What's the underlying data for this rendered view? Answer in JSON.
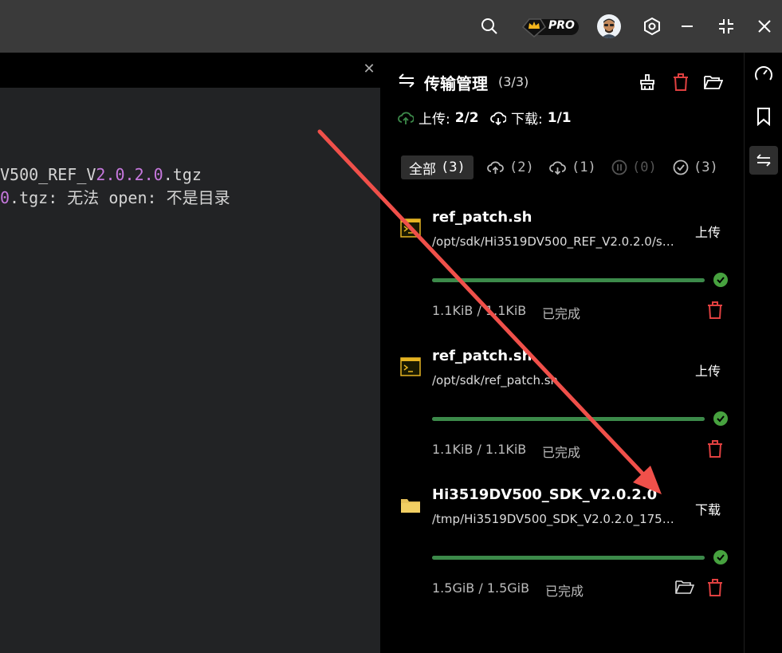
{
  "colors": {
    "accent_green": "#3c8a4a",
    "danger_red": "#e04040",
    "arrow_red": "#f0504a",
    "terminal_purple": "#c678dd"
  },
  "titlebar": {
    "badge": "PRO"
  },
  "terminal": {
    "line1": {
      "a": "V500_REF_V",
      "b": "2.0.2.0",
      "c": ".tgz"
    },
    "line2": {
      "a": "0",
      "b": ".tgz: 无法 open: 不是目录"
    }
  },
  "panel": {
    "title": "传输管理",
    "count": "(3/3)",
    "upload_label": "上传:",
    "upload_value": "2/2",
    "download_label": "下载:",
    "download_value": "1/1",
    "filters": [
      {
        "label": "全部",
        "count": "(3)"
      },
      {
        "count": "(2)"
      },
      {
        "count": "(1)"
      },
      {
        "count": "(0)"
      },
      {
        "count": "(3)"
      }
    ],
    "items": [
      {
        "name": "ref_patch.sh",
        "path": "/opt/sdk/Hi3519DV500_REF_V2.0.2.0/sm...",
        "direction": "上传",
        "size": "1.1KiB / 1.1KiB",
        "status": "已完成",
        "progress": 1.0
      },
      {
        "name": "ref_patch.sh",
        "path": "/opt/sdk/ref_patch.sh",
        "direction": "上传",
        "size": "1.1KiB / 1.1KiB",
        "status": "已完成",
        "progress": 1.0
      },
      {
        "name": "Hi3519DV500_SDK_V2.0.2.0",
        "path": "/tmp/Hi3519DV500_SDK_V2.0.2.0_17570...",
        "direction": "下载",
        "size": "1.5GiB / 1.5GiB",
        "status": "已完成",
        "progress": 1.0
      }
    ]
  }
}
